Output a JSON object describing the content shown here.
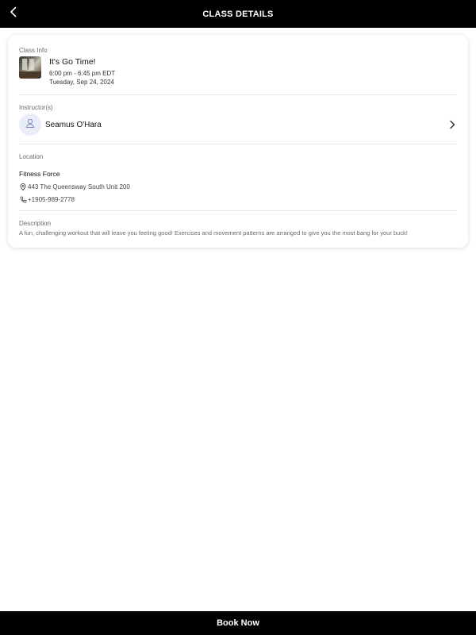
{
  "header": {
    "title": "CLASS DETAILS",
    "back_icon": "chevron-left-icon"
  },
  "class_info": {
    "section_label": "Class Info",
    "name": "It's Go Time!",
    "time": "6:00 pm - 6:45 pm EDT",
    "date": "Tuesday, Sep 24, 2024"
  },
  "instructors": {
    "section_label": "Instructor(s)",
    "items": [
      {
        "name": "Seamus O'Hara",
        "avatar_icon": "person-icon"
      }
    ]
  },
  "location": {
    "section_label": "Location",
    "studio": "Fitness Force",
    "address": "443 The Queensway South Unit 200",
    "phone": "+1905-989-2778"
  },
  "description": {
    "section_label": "Description",
    "text": "A fun, challenging workout that will leave you feeling good! Exercises and movement patterns are arranged to give you the most bang for your buck!"
  },
  "footer": {
    "book_label": "Book Now"
  },
  "colors": {
    "bar": "#000000",
    "avatar_bg": "#e9edf8",
    "avatar_icon": "#7f8fc0"
  }
}
